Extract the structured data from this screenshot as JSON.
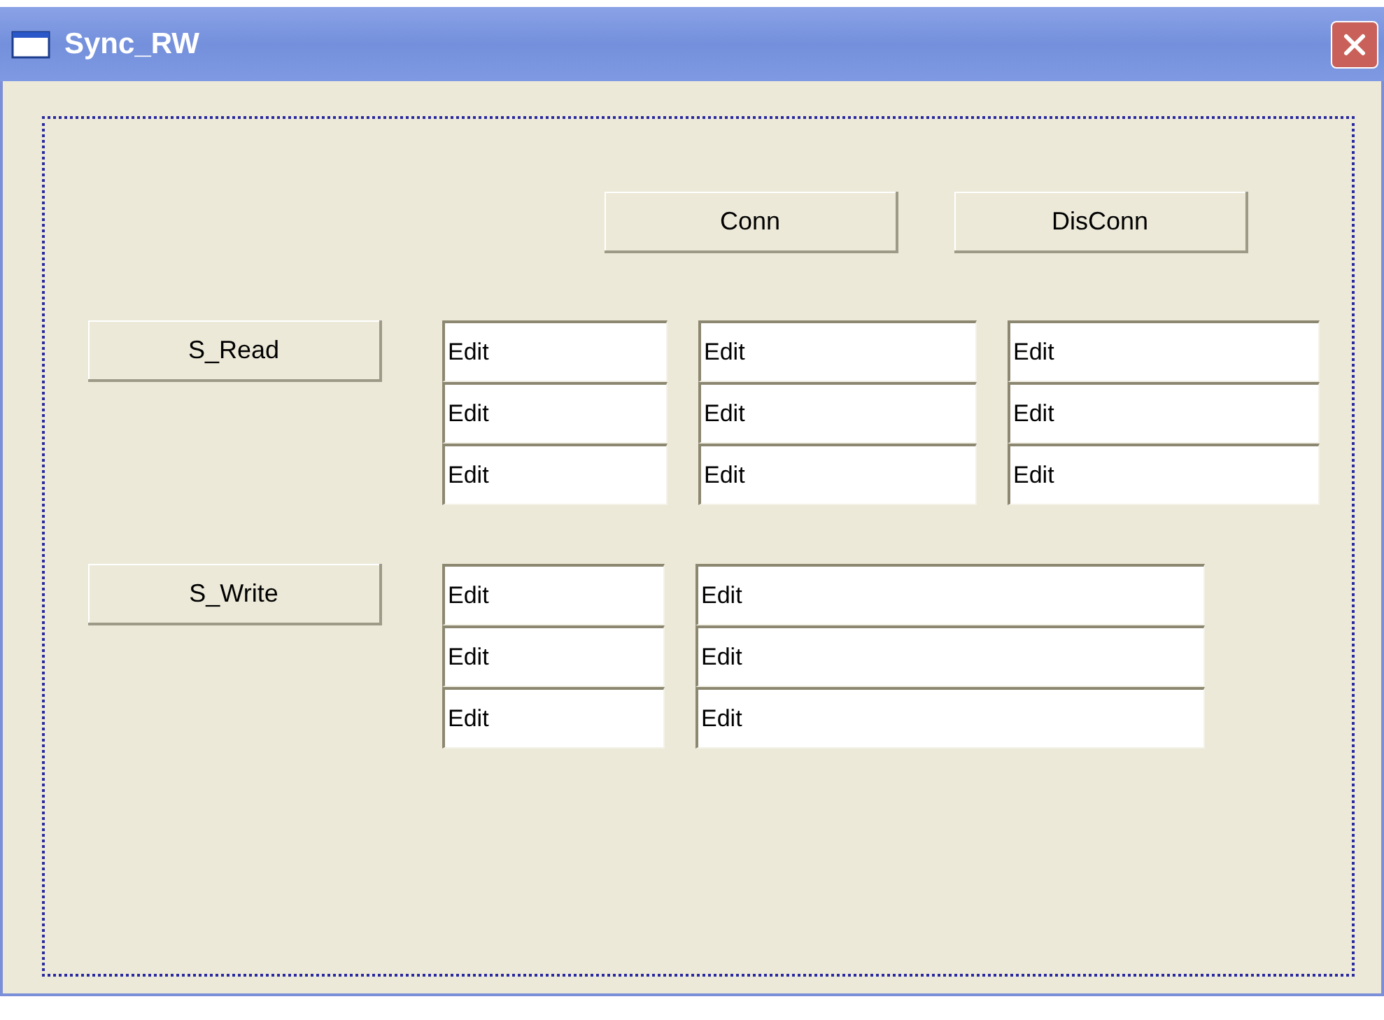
{
  "window": {
    "title": "Sync_RW"
  },
  "top_buttons": [
    "Conn",
    "DisConn"
  ],
  "sections": [
    {
      "kind": "read",
      "button": "S_Read",
      "rows": [
        [
          "Edit",
          "Edit",
          "Edit"
        ],
        [
          "Edit",
          "Edit",
          "Edit"
        ],
        [
          "Edit",
          "Edit",
          "Edit"
        ]
      ]
    },
    {
      "kind": "write",
      "button": "S_Write",
      "rows": [
        [
          "Edit",
          "Edit"
        ],
        [
          "Edit",
          "Edit"
        ],
        [
          "Edit",
          "Edit"
        ]
      ]
    }
  ]
}
